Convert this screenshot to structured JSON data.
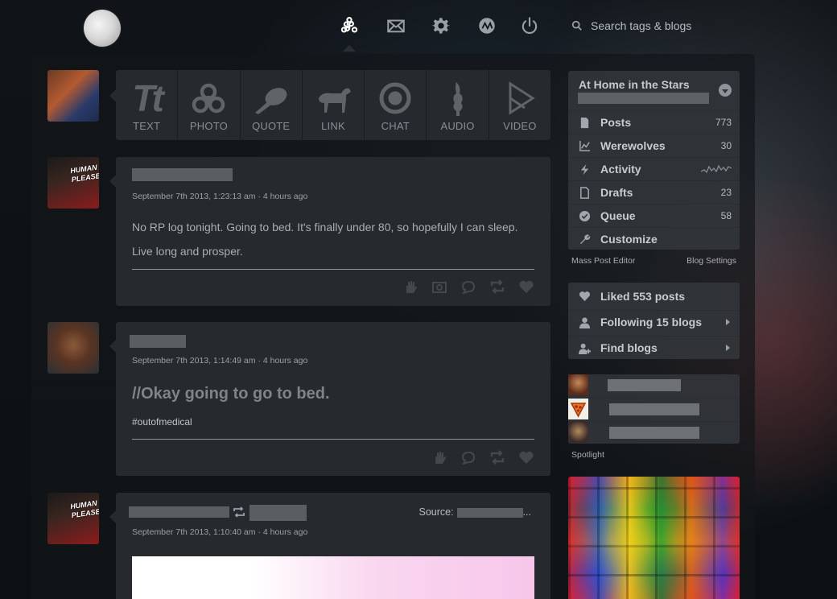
{
  "nav": {
    "search_placeholder": "Search tags & blogs"
  },
  "post_types": [
    {
      "label": "TEXT",
      "glyph": "Tt"
    },
    {
      "label": "PHOTO"
    },
    {
      "label": "QUOTE"
    },
    {
      "label": "LINK"
    },
    {
      "label": "CHAT"
    },
    {
      "label": "AUDIO"
    },
    {
      "label": "VIDEO"
    }
  ],
  "avatars": {
    "human_please_text": "HUMAN PLEASE"
  },
  "posts": [
    {
      "date": "September 7th 2013, 1:23:13 am · 4 hours ago",
      "body_line1": "No RP log tonight. Going to bed. It's finally under 80, so hopefully I can sleep.",
      "body_line2": "Live long and prosper."
    },
    {
      "date": "September 7th 2013, 1:14:49 am · 4 hours ago",
      "quote": "//Okay going to go to bed.",
      "tag": "#outofmedical"
    },
    {
      "date": "September 7th 2013, 1:10:40 am · 4 hours ago",
      "source_label": "Source:",
      "source_suffix": "..."
    }
  ],
  "blog": {
    "title": "At Home in the Stars",
    "rows": [
      {
        "label": "Posts",
        "count": "773",
        "icon": "page-icon"
      },
      {
        "label": "Werewolves",
        "count": "30",
        "icon": "chart-icon"
      },
      {
        "label": "Activity",
        "icon": "lightning-icon"
      },
      {
        "label": "Drafts",
        "count": "23",
        "icon": "page-icon"
      },
      {
        "label": "Queue",
        "count": "58",
        "icon": "check-circle-icon"
      },
      {
        "label": "Customize",
        "icon": "wrench-icon"
      }
    ],
    "mass_post_editor": "Mass Post Editor",
    "blog_settings": "Blog Settings"
  },
  "account": {
    "liked": "Liked 553 posts",
    "following": "Following 15 blogs",
    "find": "Find blogs"
  },
  "spotlight_label": "Spotlight"
}
